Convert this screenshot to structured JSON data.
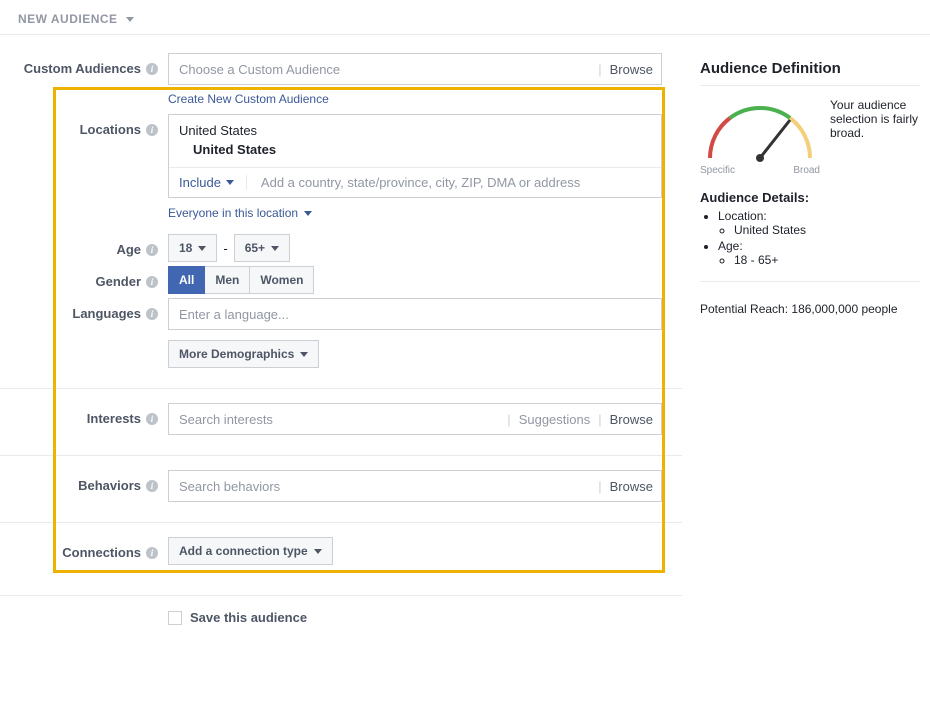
{
  "header": {
    "title": "NEW AUDIENCE"
  },
  "customAudiences": {
    "label": "Custom Audiences",
    "placeholder": "Choose a Custom Audience",
    "browse": "Browse",
    "createLink": "Create New Custom Audience"
  },
  "locations": {
    "label": "Locations",
    "country": "United States",
    "subCountry": "United States",
    "includeLabel": "Include",
    "addPlaceholder": "Add a country, state/province, city, ZIP, DMA or address",
    "scopeLabel": "Everyone in this location"
  },
  "age": {
    "label": "Age",
    "min": "18",
    "max": "65+"
  },
  "gender": {
    "label": "Gender",
    "options": {
      "all": "All",
      "men": "Men",
      "women": "Women"
    }
  },
  "languages": {
    "label": "Languages",
    "placeholder": "Enter a language..."
  },
  "moreDemographics": {
    "label": "More Demographics"
  },
  "interests": {
    "label": "Interests",
    "placeholder": "Search interests",
    "suggestions": "Suggestions",
    "browse": "Browse"
  },
  "behaviors": {
    "label": "Behaviors",
    "placeholder": "Search behaviors",
    "browse": "Browse"
  },
  "connections": {
    "label": "Connections",
    "button": "Add a connection type"
  },
  "saveAudience": {
    "label": "Save this audience"
  },
  "rightPanel": {
    "title": "Audience Definition",
    "gauge": {
      "specific": "Specific",
      "broad": "Broad"
    },
    "description": "Your audience selection is fairly broad.",
    "detailsHeader": "Audience Details:",
    "locationLabel": "Location:",
    "locationValue": "United States",
    "ageLabel": "Age:",
    "ageValue": "18 - 65+",
    "reach": "Potential Reach: 186,000,000 people"
  }
}
